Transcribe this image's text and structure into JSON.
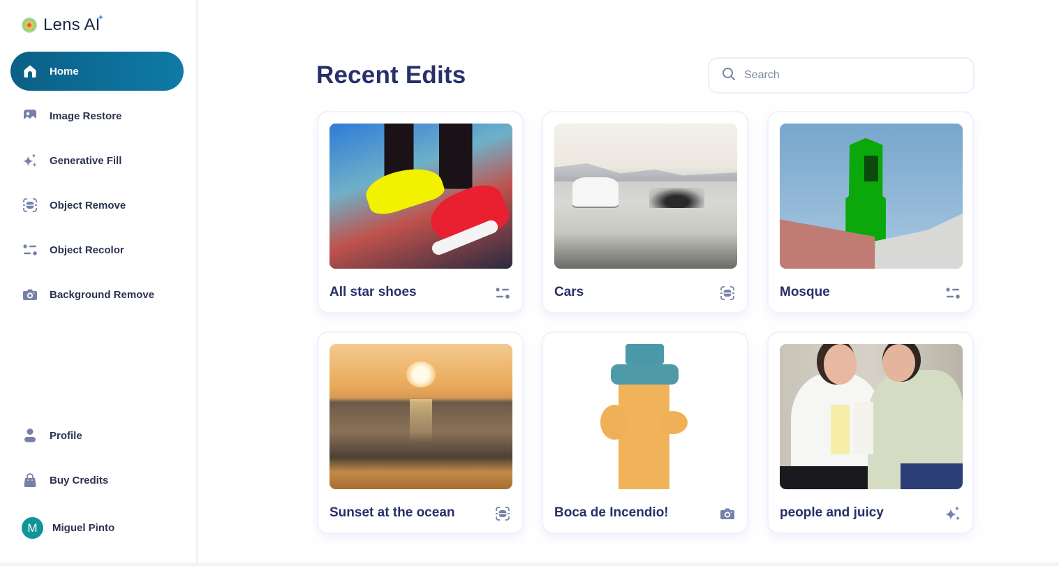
{
  "app": {
    "name": "Lens AI",
    "logo_icon": "lens-flower-icon",
    "accent_color": "#0e7ba6"
  },
  "sidebar": {
    "items": [
      {
        "label": "Home",
        "icon": "home-icon",
        "active": true
      },
      {
        "label": "Image Restore",
        "icon": "image-icon",
        "active": false
      },
      {
        "label": "Generative Fill",
        "icon": "sparkles-icon",
        "active": false
      },
      {
        "label": "Object Remove",
        "icon": "scan-object-icon",
        "active": false
      },
      {
        "label": "Object Recolor",
        "icon": "sliders-icon",
        "active": false
      },
      {
        "label": "Background Remove",
        "icon": "camera-icon",
        "active": false
      }
    ],
    "bottom_items": [
      {
        "label": "Profile",
        "icon": "user-icon"
      },
      {
        "label": "Buy Credits",
        "icon": "shopping-bag-icon"
      }
    ],
    "user": {
      "initial": "M",
      "name": "Miguel Pinto",
      "avatar_color": "#11939a"
    }
  },
  "main": {
    "title": "Recent Edits",
    "search": {
      "placeholder": "Search",
      "value": ""
    },
    "cards": [
      {
        "title": "All star shoes",
        "tool_icon": "sliders-icon",
        "tool": "Object Recolor"
      },
      {
        "title": "Cars",
        "tool_icon": "scan-object-icon",
        "tool": "Object Remove"
      },
      {
        "title": "Mosque",
        "tool_icon": "sliders-icon",
        "tool": "Object Recolor"
      },
      {
        "title": "Sunset at the ocean",
        "tool_icon": "scan-object-icon",
        "tool": "Object Remove"
      },
      {
        "title": "Boca de Incendio!",
        "tool_icon": "camera-icon",
        "tool": "Background Remove"
      },
      {
        "title": "people and juicy",
        "tool_icon": "sparkles-icon",
        "tool": "Generative Fill"
      }
    ]
  }
}
